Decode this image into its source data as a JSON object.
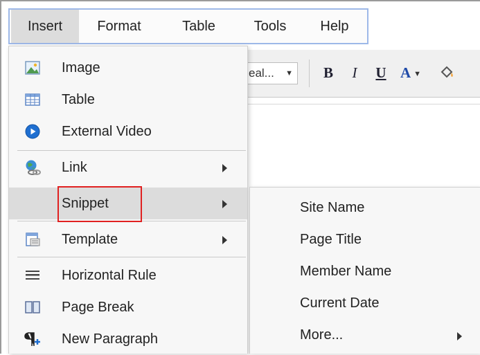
{
  "menubar": {
    "items": [
      {
        "label": "Insert",
        "active": true
      },
      {
        "label": "Format"
      },
      {
        "label": "Table"
      },
      {
        "label": "Tools"
      },
      {
        "label": "Help"
      }
    ]
  },
  "toolbar": {
    "font_select_value": "eal...",
    "bold_label": "B",
    "italic_label": "I",
    "underline_label": "U",
    "text_color_label": "A"
  },
  "insert_menu": {
    "items": [
      {
        "label": "Image",
        "icon": "image-icon"
      },
      {
        "label": "Table",
        "icon": "table-icon"
      },
      {
        "label": "External Video",
        "icon": "video-play-icon"
      },
      {
        "label": "Link",
        "icon": "link-icon",
        "submenu": true
      },
      {
        "label": "Snippet",
        "icon": "none",
        "submenu": true,
        "highlighted": true
      },
      {
        "label": "Template",
        "icon": "template-icon",
        "submenu": true
      },
      {
        "label": "Horizontal Rule",
        "icon": "horizontal-rule-icon"
      },
      {
        "label": "Page Break",
        "icon": "page-break-icon"
      },
      {
        "label": "New Paragraph",
        "icon": "new-paragraph-icon"
      }
    ]
  },
  "snippet_submenu": {
    "items": [
      {
        "label": "Site Name"
      },
      {
        "label": "Page Title"
      },
      {
        "label": "Member Name"
      },
      {
        "label": "Current Date"
      },
      {
        "label": "More...",
        "submenu": true
      }
    ]
  },
  "colors": {
    "menubar_border": "#9db8e8",
    "highlight": "#dcdcdc",
    "annotation_box": "#e02020"
  }
}
